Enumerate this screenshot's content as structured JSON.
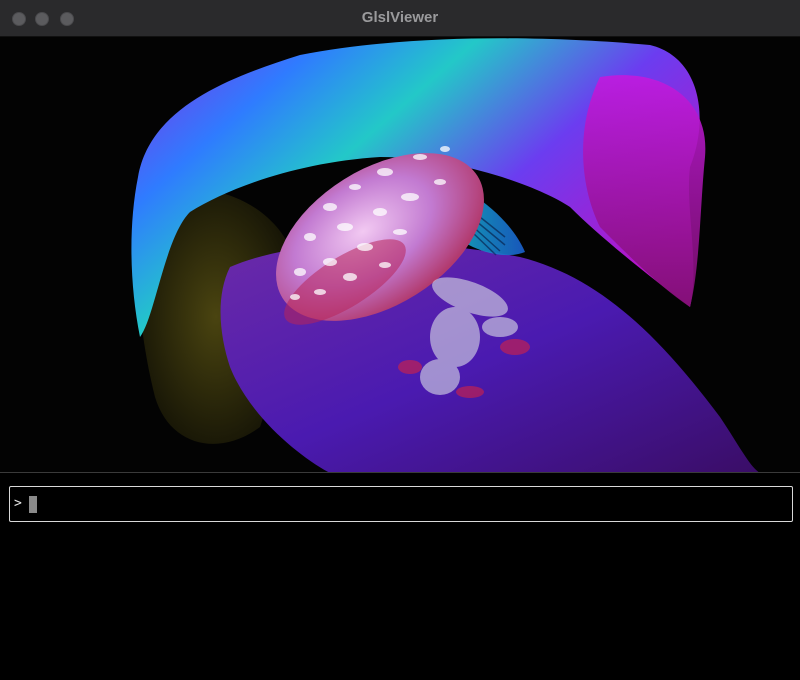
{
  "window": {
    "title": "GlslViewer",
    "controls": [
      "close-icon",
      "minimize-icon",
      "maximize-icon"
    ]
  },
  "viewport": {
    "content": "shader-render-jellyfish"
  },
  "console": {
    "prompt_symbol": ">",
    "input_value": "",
    "cursor": "block-cursor"
  },
  "colors": {
    "titlebar": "#2a2a2c",
    "background": "#000000",
    "console_border": "#d9d9d9"
  }
}
